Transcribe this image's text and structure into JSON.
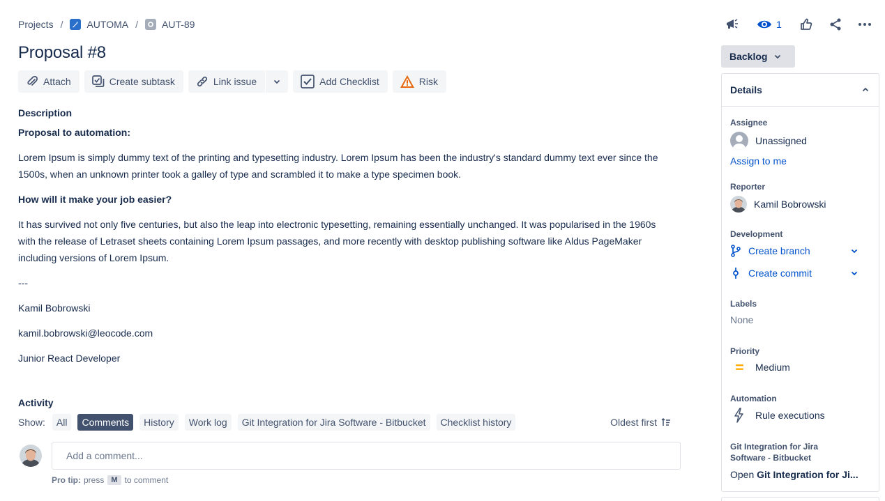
{
  "breadcrumb": {
    "projects": "Projects",
    "project": "AUTOMA",
    "issue_key": "AUT-89",
    "separator": "/"
  },
  "top_actions": {
    "watch_count": "1",
    "icons": [
      "megaphone-icon",
      "eye-icon",
      "thumbs-up-icon",
      "share-icon",
      "more-icon"
    ]
  },
  "issue": {
    "title": "Proposal #8"
  },
  "toolbar": {
    "attach": "Attach",
    "create_subtask": "Create subtask",
    "link_issue": "Link issue",
    "add_checklist": "Add Checklist",
    "risk": "Risk"
  },
  "description": {
    "label": "Description",
    "heading1": "Proposal to automation:",
    "para1": "Lorem Ipsum is simply dummy text of the printing and typesetting industry. Lorem Ipsum has been the industry's standard dummy text ever since the 1500s, when an unknown printer took a galley of type and scrambled it to make a type specimen book.",
    "heading2": "How will it make your job easier?",
    "para2": "It has survived not only five centuries, but also the leap into electronic typesetting, remaining essentially unchanged. It was popularised in the 1960s with the release of Letraset sheets containing Lorem Ipsum passages, and more recently with desktop publishing software like Aldus PageMaker including versions of Lorem Ipsum.",
    "divider": "---",
    "author_name": "Kamil Bobrowski",
    "author_email": "kamil.bobrowski@leocode.com",
    "author_role": "Junior React Developer"
  },
  "activity": {
    "label": "Activity",
    "show": "Show:",
    "filters": [
      "All",
      "Comments",
      "History",
      "Work log",
      "Git Integration for Jira Software - Bitbucket",
      "Checklist history"
    ],
    "active_filter": "Comments",
    "sort": "Oldest first",
    "comment_placeholder": "Add a comment...",
    "protip_bold": "Pro tip:",
    "protip_press": "press",
    "protip_key": "M",
    "protip_end": "to comment"
  },
  "sidebar": {
    "status": "Backlog",
    "details_title": "Details",
    "assignee_label": "Assignee",
    "assignee_value": "Unassigned",
    "assign_to_me": "Assign to me",
    "reporter_label": "Reporter",
    "reporter_value": "Kamil Bobrowski",
    "development_label": "Development",
    "create_branch": "Create branch",
    "create_commit": "Create commit",
    "labels_label": "Labels",
    "labels_value": "None",
    "priority_label": "Priority",
    "priority_value": "Medium",
    "automation_label": "Automation",
    "automation_value": "Rule executions",
    "git_label_line1": "Git Integration for Jira",
    "git_label_line2": "Software - Bitbucket",
    "git_open": "Open",
    "git_open_bold": "Git Integration for Ji..."
  },
  "colors": {
    "link": "#0052cc",
    "text": "#172b4d",
    "subtle": "#42526e",
    "risk": "#e56910",
    "priority_medium": "#ffab00"
  }
}
